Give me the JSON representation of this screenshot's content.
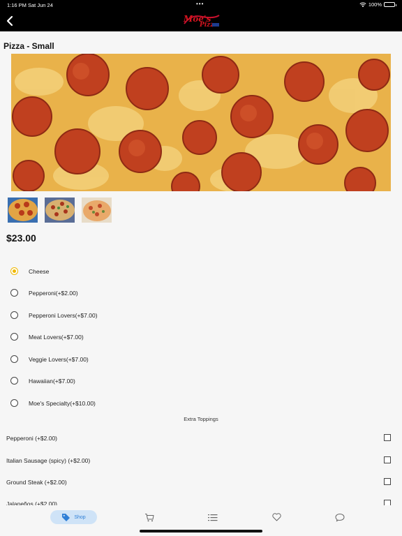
{
  "status_bar": {
    "time": "1:16 PM",
    "date": "Sat Jun 24",
    "battery": "100%",
    "battery_level": 1.0
  },
  "header": {
    "back_icon": "chevron-left-icon",
    "logo_text": "Moe's",
    "logo_subtext": "Pizza"
  },
  "product": {
    "title": "Pizza - Small",
    "price": "$23.00"
  },
  "options": [
    {
      "label": "Cheese",
      "selected": true
    },
    {
      "label": "Pepperoni(+$2.00)",
      "selected": false
    },
    {
      "label": "Pepperoni Lovers(+$7.00)",
      "selected": false
    },
    {
      "label": "Meat Lovers(+$7.00)",
      "selected": false
    },
    {
      "label": "Veggie Lovers(+$7.00)",
      "selected": false
    },
    {
      "label": "Hawaiian(+$7.00)",
      "selected": false
    },
    {
      "label": "Moe's Specialty(+$10.00)",
      "selected": false
    }
  ],
  "extras": {
    "heading": "Extra Toppings",
    "items": [
      {
        "label": "Pepperoni (+$2.00)",
        "checked": false
      },
      {
        "label": "Italian Sausage (spicy) (+$2.00)",
        "checked": false
      },
      {
        "label": "Ground Steak (+$2.00)",
        "checked": false
      },
      {
        "label": "Jalapeños (+$2.00)",
        "checked": false
      }
    ]
  },
  "tabbar": {
    "shop_label": "Shop",
    "tabs": [
      "tag-icon",
      "cart-icon",
      "list-icon",
      "heart-icon",
      "chat-icon"
    ]
  },
  "colors": {
    "accent": "#f0b800",
    "tab_active_bg": "#cfe3f7",
    "tab_active_fg": "#2f7fd6",
    "header_bg": "#000000"
  }
}
